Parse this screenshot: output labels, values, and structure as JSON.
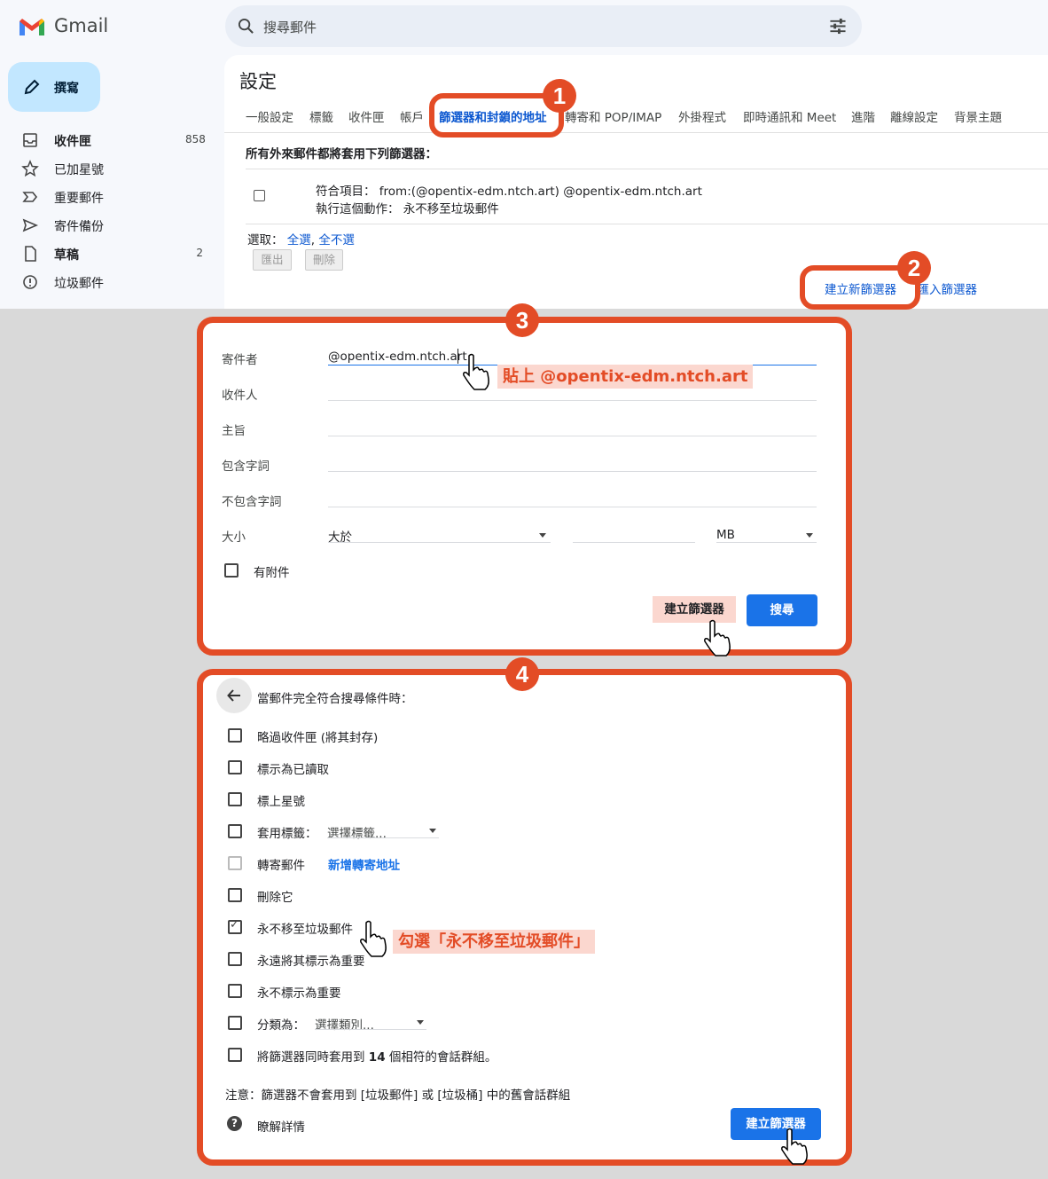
{
  "app": {
    "name": "Gmail"
  },
  "search": {
    "placeholder": "搜尋郵件"
  },
  "compose": {
    "label": "撰寫"
  },
  "sidebar": {
    "items": [
      {
        "label": "收件匣",
        "count": "858",
        "bold": true
      },
      {
        "label": "已加星號",
        "count": ""
      },
      {
        "label": "重要郵件",
        "count": ""
      },
      {
        "label": "寄件備份",
        "count": ""
      },
      {
        "label": "草稿",
        "count": "2",
        "bold": true
      },
      {
        "label": "垃圾郵件",
        "count": ""
      }
    ]
  },
  "settings": {
    "title": "設定",
    "tabs": [
      "一般設定",
      "標籤",
      "收件匣",
      "帳戶",
      "篩選器和封鎖的地址",
      "轉寄和 POP/IMAP",
      "外掛程式",
      "即時通訊和 Meet",
      "進階",
      "離線設定",
      "背景主題"
    ],
    "active_tab": "篩選器和封鎖的地址",
    "filters_header": "所有外來郵件都將套用下列篩選器：",
    "filter_match": "符合項目： from:(@opentix-edm.ntch.art) @opentix-edm.ntch.art",
    "filter_action": "執行這個動作： 永不移至垃圾郵件",
    "select_label": "選取：",
    "select_all": "全選",
    "select_none": "全不選",
    "export_btn": "匯出",
    "delete_btn": "刪除",
    "create_new_filter": "建立新篩選器",
    "import_filter": "匯入篩選器"
  },
  "badges": {
    "b1": "1",
    "b2": "2",
    "b3": "3",
    "b4": "4"
  },
  "search_form": {
    "from_label": "寄件者",
    "from_value": "@opentix-edm.ntch.art",
    "to_label": "收件人",
    "subject_label": "主旨",
    "has_words_label": "包含字詞",
    "no_words_label": "不包含字詞",
    "size_label": "大小",
    "size_op": "大於",
    "size_unit": "MB",
    "has_attachment_label": "有附件",
    "create_filter_btn": "建立篩選器",
    "search_btn": "搜尋",
    "paste_note": "貼上 @opentix-edm.ntch.art"
  },
  "filter_actions": {
    "header": "當郵件完全符合搜尋條件時：",
    "options": [
      {
        "label": "略過收件匣 (將其封存)",
        "checked": false
      },
      {
        "label": "標示為已讀取",
        "checked": false
      },
      {
        "label": "標上星號",
        "checked": false
      },
      {
        "label": "套用標籤：",
        "checked": false
      },
      {
        "label": "轉寄郵件",
        "checked": false,
        "disabled": true
      },
      {
        "label": "刪除它",
        "checked": false
      },
      {
        "label": "永不移至垃圾郵件",
        "checked": true
      },
      {
        "label": "永遠將其標示為重要",
        "checked": false
      },
      {
        "label": "永不標示為重要",
        "checked": false
      },
      {
        "label": "分類為：",
        "checked": false
      },
      {
        "label_prefix": "將篩選器同時套用到 ",
        "count": "14",
        "label_suffix": " 個相符的會話群組。",
        "checked": false
      }
    ],
    "label_select": "選擇標籤...",
    "forward_link": "新增轉寄地址",
    "category_select": "選擇類別...",
    "note": "注意：篩選器不會套用到 [垃圾郵件] 或 [垃圾桶] 中的舊會話群組",
    "learn_more": "瞭解詳情",
    "create_filter_btn": "建立篩選器",
    "check_note": "勾選「永不移至垃圾郵件」"
  },
  "colors": {
    "accent": "#e34c26",
    "link": "#0b57d0",
    "primary_btn": "#1a73e8",
    "highlight": "#fbd7cf"
  }
}
